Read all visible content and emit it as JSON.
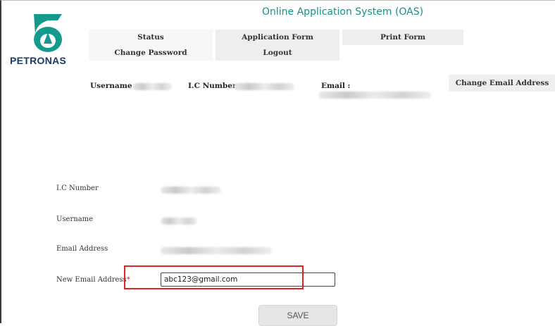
{
  "brand": {
    "name": "PETRONAS"
  },
  "header": {
    "title": "Online Application System (OAS)"
  },
  "nav": {
    "status": "Status",
    "application_form": "Application Form",
    "print_form": "Print Form",
    "change_password": "Change Password",
    "logout": "Logout"
  },
  "user_info": {
    "username_label": "Username :",
    "ic_label": "I.C Number :",
    "email_label": "Email :"
  },
  "change_email_button": "Change Email Address",
  "form": {
    "ic_label": "I.C Number",
    "username_label": "Username",
    "email_label": "Email Address",
    "new_email_label": "New Email Address",
    "required_mark": "*",
    "new_email_value": "abc123@gmail.com",
    "save_label": "SAVE"
  },
  "colors": {
    "title_teal": "#14928a",
    "brand_navy": "#1d3a66",
    "highlight_red": "#e02424",
    "required_red": "#d2222d"
  }
}
